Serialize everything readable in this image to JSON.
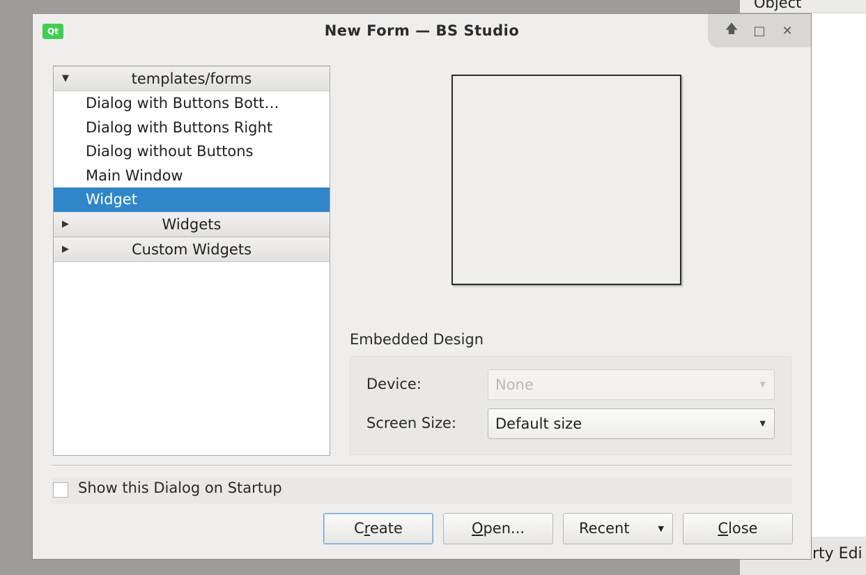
{
  "background_window": {
    "header_text": "Object",
    "bottom_text": "rty Edi"
  },
  "dialog": {
    "title": "New Form — BS Studio",
    "logo_text": "Qt",
    "controls": {
      "minimize": "🡅",
      "maximize": "□",
      "close": "✕"
    }
  },
  "templates": {
    "categories": [
      {
        "label": "templates/forms",
        "expanded": true,
        "items": [
          {
            "label": "Dialog with Buttons Bott…",
            "selected": false
          },
          {
            "label": "Dialog with Buttons Right",
            "selected": false
          },
          {
            "label": "Dialog without Buttons",
            "selected": false
          },
          {
            "label": "Main Window",
            "selected": false
          },
          {
            "label": "Widget",
            "selected": true
          }
        ]
      },
      {
        "label": "Widgets",
        "expanded": false
      },
      {
        "label": "Custom Widgets",
        "expanded": false
      }
    ],
    "arrow_expanded": "▼",
    "arrow_collapsed": "▶"
  },
  "embedded": {
    "title": "Embedded Design",
    "device_label": "Device:",
    "device_value": "None",
    "screen_label": "Screen Size:",
    "screen_value": "Default size"
  },
  "startup": {
    "label": "Show this Dialog on Startup",
    "checked": false
  },
  "buttons": {
    "create": {
      "pre": "C",
      "mnemonic": "r",
      "post": "eate"
    },
    "open": {
      "pre": "",
      "mnemonic": "O",
      "post": "pen..."
    },
    "recent": {
      "label": "Recent"
    },
    "close": {
      "pre": "",
      "mnemonic": "C",
      "post": "lose"
    },
    "dropdown_arrow": "▼"
  },
  "colors": {
    "selection": "#2f86c9",
    "qt_green": "#41cd52"
  }
}
